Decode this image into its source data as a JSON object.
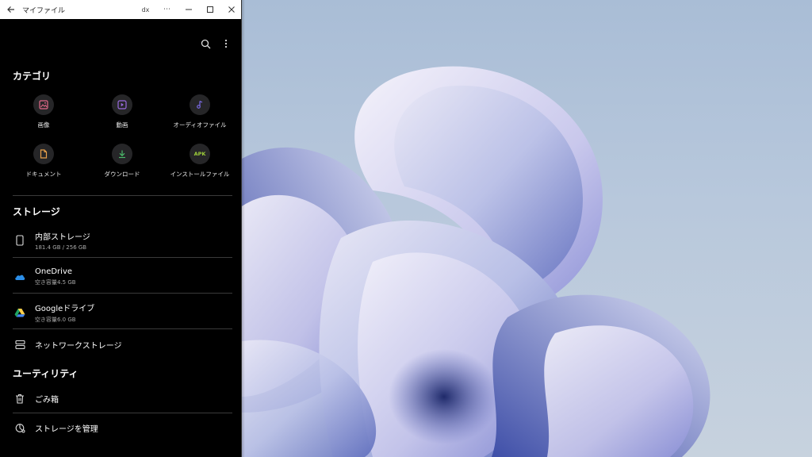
{
  "window": {
    "title": "マイファイル",
    "controls": {
      "dex": "dx",
      "more": "⋯"
    }
  },
  "categories": {
    "heading": "カテゴリ",
    "items": [
      {
        "label": "画像",
        "icon": "image-icon",
        "color": "#e46a8a"
      },
      {
        "label": "動画",
        "icon": "video-icon",
        "color": "#9b6be0"
      },
      {
        "label": "オーディオファイル",
        "icon": "music-icon",
        "color": "#7c6be8"
      },
      {
        "label": "ドキュメント",
        "icon": "document-icon",
        "color": "#e8a04a"
      },
      {
        "label": "ダウンロード",
        "icon": "download-icon",
        "color": "#4ab86a"
      },
      {
        "label": "インストールファイル",
        "icon": "apk-icon",
        "color": "#9ccc3a",
        "badge": "APK"
      }
    ]
  },
  "storage": {
    "heading": "ストレージ",
    "items": [
      {
        "label": "内部ストレージ",
        "sub": "181.4 GB / 256 GB",
        "icon": "phone-icon"
      },
      {
        "label": "OneDrive",
        "sub": "空き容量4.5 GB",
        "icon": "onedrive-icon"
      },
      {
        "label": "Googleドライブ",
        "sub": "空き容量6.0 GB",
        "icon": "google-drive-icon"
      },
      {
        "label": "ネットワークストレージ",
        "sub": "",
        "icon": "network-storage-icon"
      }
    ]
  },
  "utility": {
    "heading": "ユーティリティ",
    "items": [
      {
        "label": "ごみ箱",
        "icon": "trash-icon"
      },
      {
        "label": "ストレージを管理",
        "icon": "storage-manage-icon"
      }
    ]
  }
}
